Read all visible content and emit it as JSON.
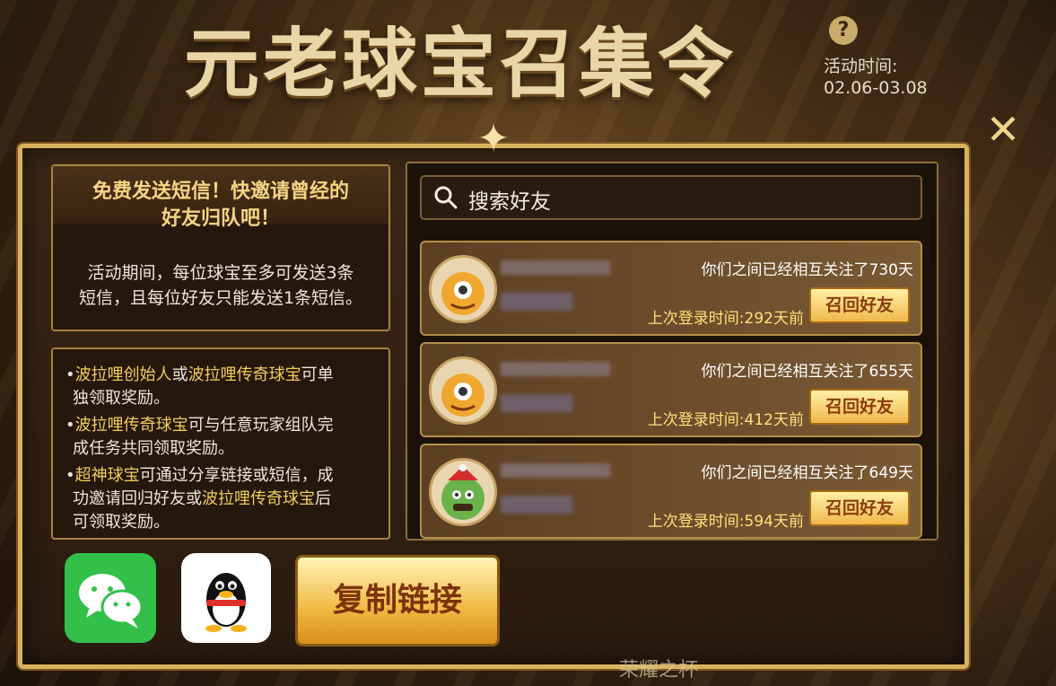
{
  "header": {
    "title": "元老球宝召集令",
    "help_icon": "question-icon",
    "help_label": "?",
    "time_label": "活动时间:",
    "time_range": "02.06-03.08",
    "close_icon": "close-icon",
    "close_label": "✕"
  },
  "left": {
    "headline_line1": "免费发送短信！快邀请曾经的",
    "headline_line2": "好友归队吧！",
    "desc_line1": "活动期间，每位球宝至多可发送3条",
    "desc_line2": "短信，且每位好友只能发送1条短信。",
    "rules": [
      {
        "line1_parts": [
          "•",
          "波拉哩创始人",
          "或",
          "波拉哩传奇球宝",
          "可单"
        ],
        "line2": "独领取奖励。"
      },
      {
        "line1_parts": [
          "•",
          "波拉哩传奇球宝",
          "可与任意玩家组队完"
        ],
        "line2": "成任务共同领取奖励。"
      },
      {
        "line1_parts": [
          "•",
          "超神球宝",
          "可通过分享链接或短信，成"
        ],
        "line2_parts": [
          "功邀请回归好友或",
          "波拉哩传奇球宝",
          "后"
        ],
        "line3": "可领取奖励。"
      }
    ]
  },
  "search": {
    "placeholder": "搜索好友",
    "icon": "search-icon"
  },
  "friends": [
    {
      "follow": "你们之间已经相互关注了730天",
      "last_login": "上次登录时间:292天前",
      "button": "召回好友",
      "avatar": "yellow-monster"
    },
    {
      "follow": "你们之间已经相互关注了655天",
      "last_login": "上次登录时间:412天前",
      "button": "召回好友",
      "avatar": "yellow-monster"
    },
    {
      "follow": "你们之间已经相互关注了649天",
      "last_login": "上次登录时间:594天前",
      "button": "召回好友",
      "avatar": "green-monster"
    }
  ],
  "share": {
    "wechat_icon": "wechat-icon",
    "qq_icon": "qq-icon",
    "copy_button": "复制链接"
  },
  "bg_text": "荣耀之杯"
}
